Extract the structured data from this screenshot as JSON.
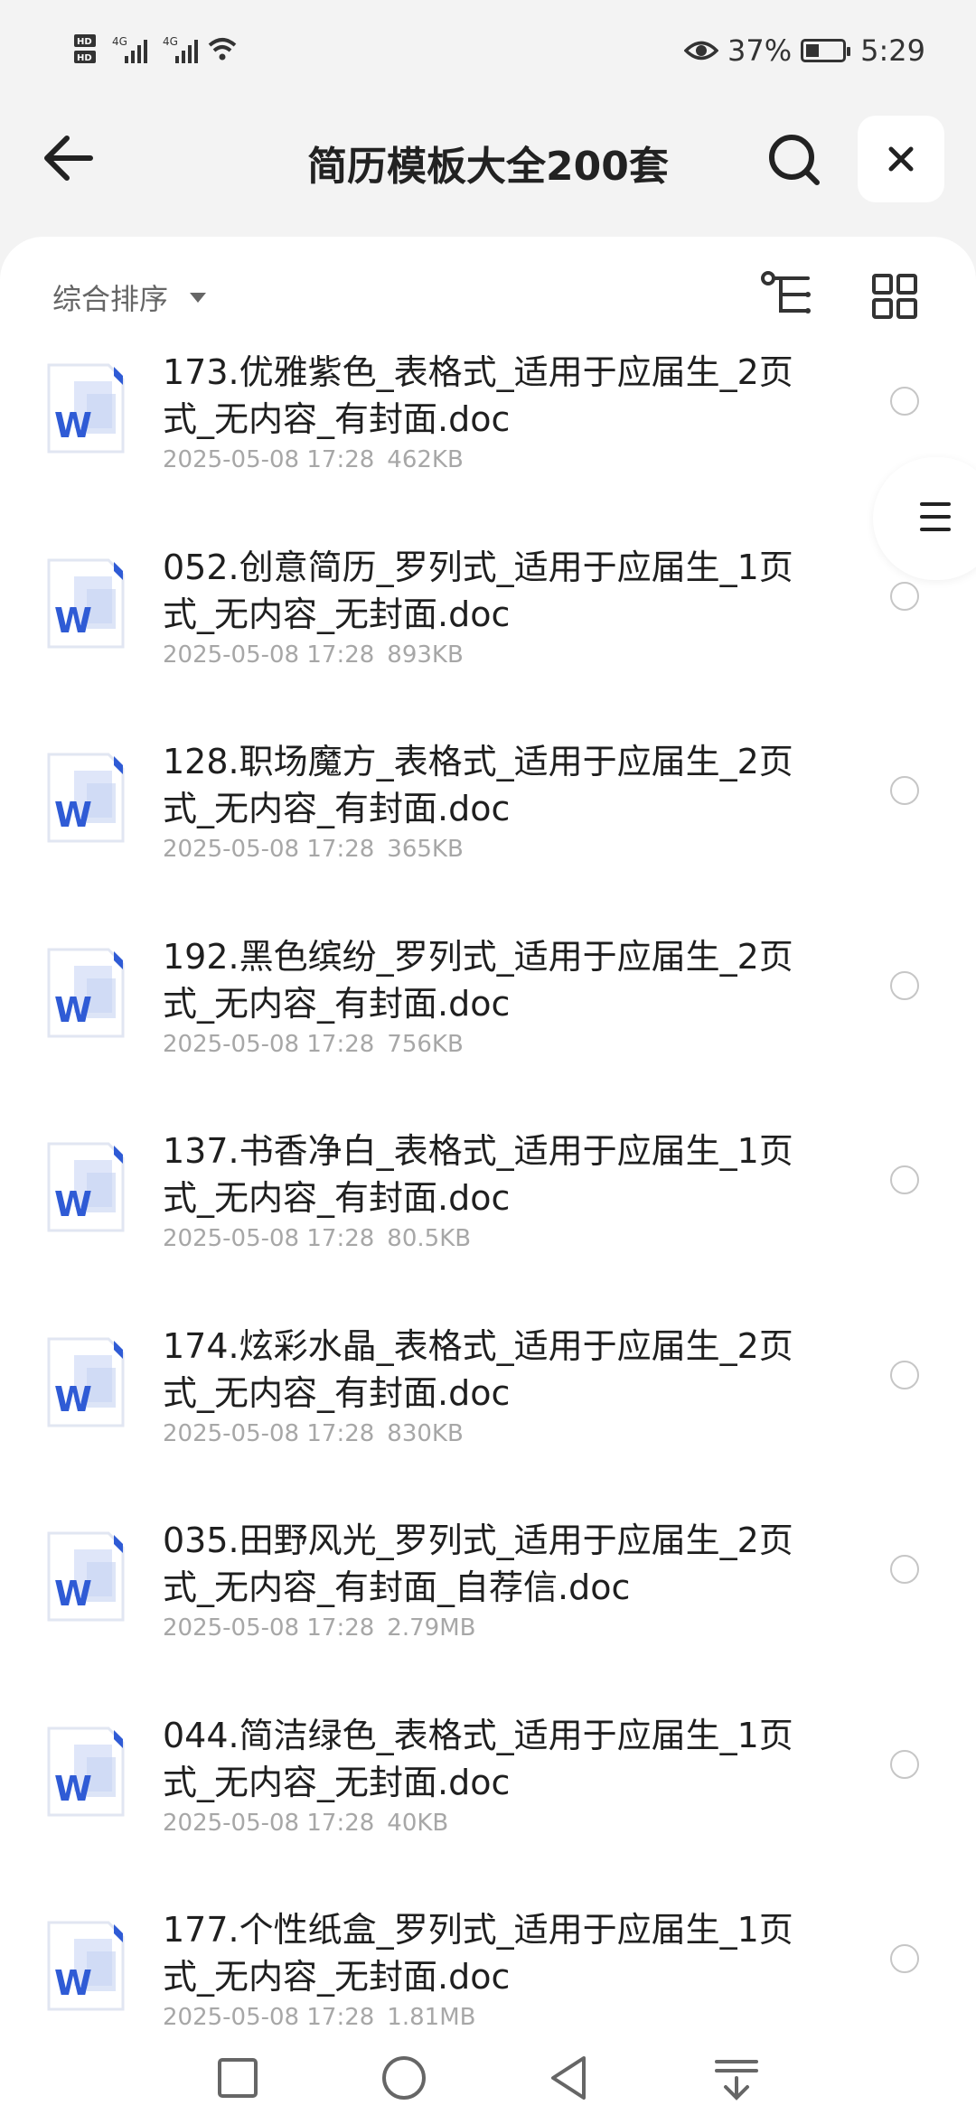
{
  "status_bar": {
    "hd1": "HD",
    "hd2": "HD",
    "net1": "4G",
    "net2": "4G",
    "battery_percent": "37%",
    "battery_level": 0.37,
    "time": "5:29",
    "icons": [
      "hd-icon",
      "signal-icon",
      "wifi-icon",
      "eye-icon",
      "battery-charging-icon"
    ]
  },
  "header": {
    "title": "简历模板大全200套",
    "icons": {
      "back": "back-arrow-icon",
      "search": "search-icon",
      "close": "close-icon"
    }
  },
  "toolbar": {
    "sort_label": "综合排序",
    "icons": {
      "sort": "caret-down-icon",
      "tree": "tree-view-icon",
      "grid": "grid-view-icon"
    }
  },
  "files": [
    {
      "name": "173.优雅紫色_表格式_适用于应届生_2页式_无内容_有封面.doc",
      "date": "2025-05-08 17:28",
      "size": "462KB"
    },
    {
      "name": "052.创意简历_罗列式_适用于应届生_1页式_无内容_无封面.doc",
      "date": "2025-05-08 17:28",
      "size": "893KB"
    },
    {
      "name": "128.职场魔方_表格式_适用于应届生_2页式_无内容_有封面.doc",
      "date": "2025-05-08 17:28",
      "size": "365KB"
    },
    {
      "name": "192.黑色缤纷_罗列式_适用于应届生_2页式_无内容_有封面.doc",
      "date": "2025-05-08 17:28",
      "size": "756KB"
    },
    {
      "name": "137.书香净白_表格式_适用于应届生_1页式_无内容_有封面.doc",
      "date": "2025-05-08 17:28",
      "size": "80.5KB"
    },
    {
      "name": "174.炫彩水晶_表格式_适用于应届生_2页式_无内容_有封面.doc",
      "date": "2025-05-08 17:28",
      "size": "830KB"
    },
    {
      "name": "035.田野风光_罗列式_适用于应届生_2页式_无内容_有封面_自荐信.doc",
      "date": "2025-05-08 17:28",
      "size": "2.79MB"
    },
    {
      "name": "044.简洁绿色_表格式_适用于应届生_1页式_无内容_无封面.doc",
      "date": "2025-05-08 17:28",
      "size": "40KB"
    },
    {
      "name": "177.个性纸盒_罗列式_适用于应届生_1页式_无内容_无封面.doc",
      "date": "2025-05-08 17:28",
      "size": "1.81MB"
    }
  ],
  "file_icon": "word-doc-icon",
  "file_icon_letter": "W",
  "colors": {
    "word_blue": "#2f5bd5",
    "word_light": "#dbe3f8"
  },
  "nav": {
    "icons": [
      "recent-apps-icon",
      "home-icon",
      "back-icon",
      "notification-pull-icon"
    ]
  }
}
